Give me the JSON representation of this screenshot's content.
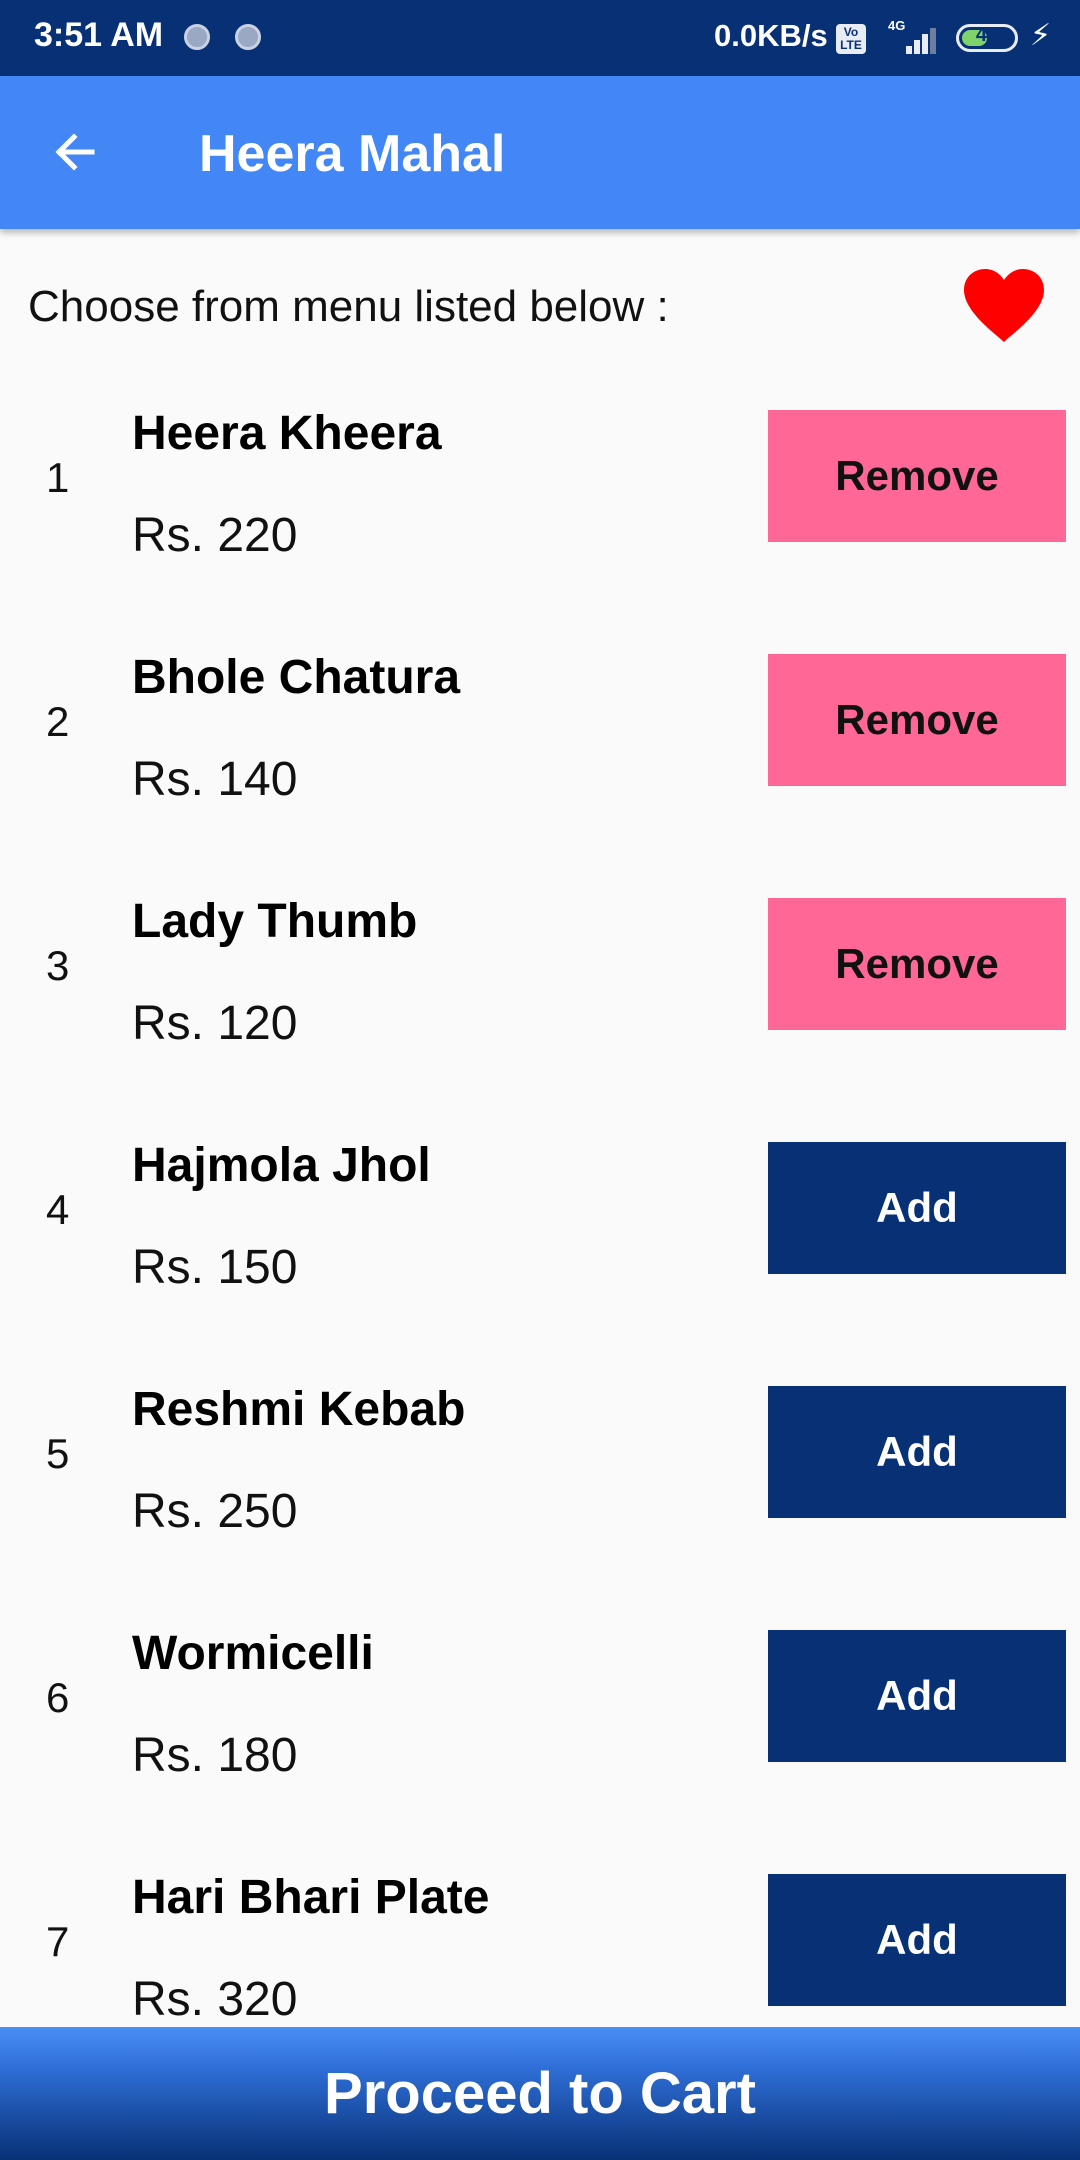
{
  "status_bar": {
    "time": "3:51 AM",
    "net_speed": "0.0KB/s",
    "volte": "Vo LTE",
    "network": "4G",
    "battery": "49",
    "icons": [
      "notification-dot-icon",
      "notification-dot-icon",
      "volte-icon",
      "signal-icon",
      "battery-icon",
      "charging-bolt-icon"
    ]
  },
  "app_bar": {
    "title": "Heera Mahal",
    "back_icon": "arrow-left-icon"
  },
  "heading": {
    "text": "Choose from menu listed below :",
    "favorite_icon": "heart-icon",
    "favorite_color": "#ff0000"
  },
  "menu": {
    "items": [
      {
        "num": "1",
        "name": "Heera Kheera",
        "price": "Rs. 220",
        "button": "Remove",
        "state": "added"
      },
      {
        "num": "2",
        "name": "Bhole Chatura",
        "price": "Rs. 140",
        "button": "Remove",
        "state": "added"
      },
      {
        "num": "3",
        "name": "Lady Thumb",
        "price": "Rs. 120",
        "button": "Remove",
        "state": "added"
      },
      {
        "num": "4",
        "name": "Hajmola Jhol",
        "price": "Rs. 150",
        "button": "Add",
        "state": "not-added"
      },
      {
        "num": "5",
        "name": "Reshmi Kebab",
        "price": "Rs. 250",
        "button": "Add",
        "state": "not-added"
      },
      {
        "num": "6",
        "name": "Wormicelli",
        "price": "Rs. 180",
        "button": "Add",
        "state": "not-added"
      },
      {
        "num": "7",
        "name": "Hari Bhari Plate",
        "price": "Rs. 320",
        "button": "Add",
        "state": "not-added"
      }
    ]
  },
  "cart": {
    "label": "Proceed to Cart"
  },
  "colors": {
    "status_bar": "#083175",
    "app_bar": "#4287f5",
    "remove_button": "#fe6796",
    "add_button": "#083175",
    "background": "#fafafa"
  }
}
